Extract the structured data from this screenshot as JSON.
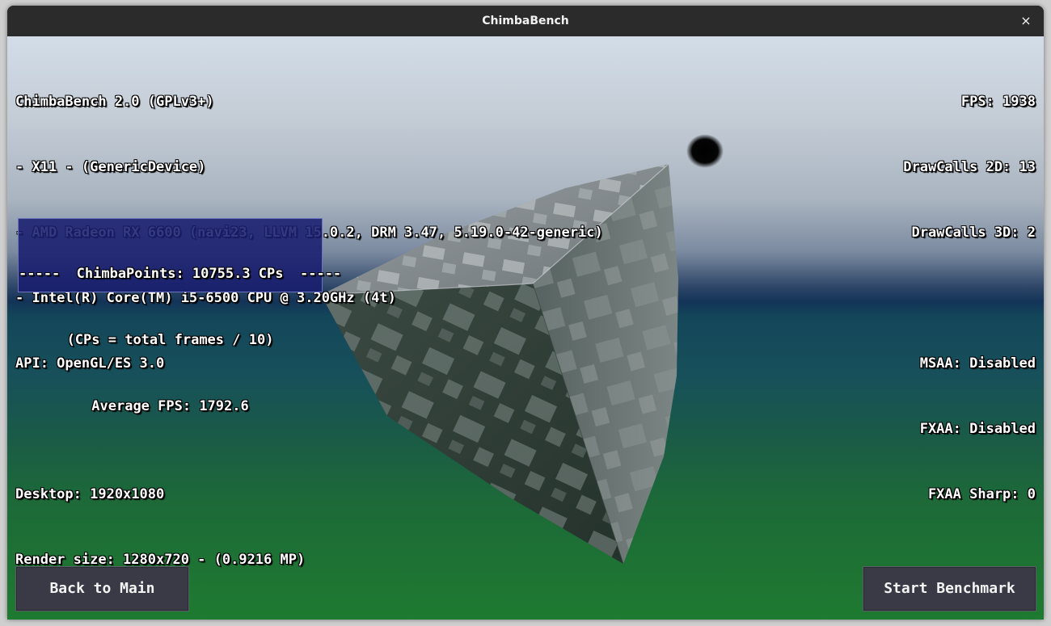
{
  "window": {
    "title": "ChimbaBench",
    "close_glyph": "×"
  },
  "hud_left": {
    "lines": [
      "ChimbaBench 2.0 (GPLv3+)",
      "- X11 - (GenericDevice)",
      "- AMD Radeon RX 6600 (navi23, LLVM 15.0.2, DRM 3.47, 5.19.0-42-generic)",
      "- Intel(R) Core(TM) i5-6500 CPU @ 3.20GHz (4t)",
      "API: OpenGL/ES 3.0",
      "",
      "Desktop: 1920x1080",
      "Render size: 1280x720 - (0.9216 MP)"
    ]
  },
  "hud_right": {
    "lines": [
      "FPS: 1938",
      "DrawCalls 2D: 13",
      "DrawCalls 3D: 2",
      "",
      "MSAA: Disabled",
      "FXAA: Disabled",
      "FXAA Sharp: 0"
    ]
  },
  "score": {
    "points_line": "-----  ChimbaPoints: 10755.3 CPs  -----",
    "formula_line": "(CPs = total frames / 10)",
    "avg_fps_line": "Average FPS: 1792.6"
  },
  "buttons": {
    "back_label": "Back to Main",
    "start_label": "Start Benchmark"
  },
  "colors": {
    "titlebar": "#2b2b2b",
    "score_box": "#191e6e",
    "button_bg": "#3a3a46",
    "sky_top": "#d3dde7",
    "horizon": "#133458",
    "ground": "#1e7a30"
  }
}
